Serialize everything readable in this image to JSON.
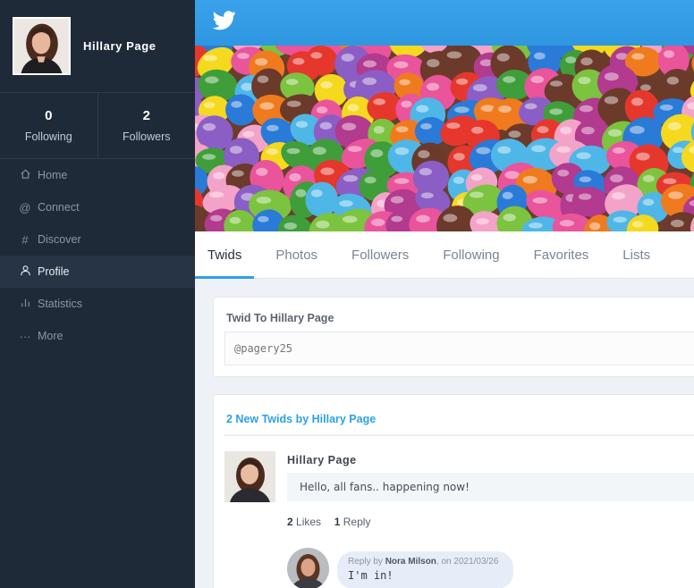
{
  "profile": {
    "name": "Hillary Page"
  },
  "stats": [
    {
      "value": "0",
      "label": "Following"
    },
    {
      "value": "2",
      "label": "Followers"
    }
  ],
  "nav": [
    {
      "icon": "home-icon",
      "label": "Home"
    },
    {
      "icon": "at-icon",
      "label": "Connect"
    },
    {
      "icon": "hash-icon",
      "label": "Discover"
    },
    {
      "icon": "user-icon",
      "label": "Profile",
      "active": true
    },
    {
      "icon": "bar-chart-icon",
      "label": "Statistics"
    },
    {
      "icon": "more-icon",
      "label": "More"
    }
  ],
  "tabs": [
    "Twids",
    "Photos",
    "Followers",
    "Following",
    "Favorites",
    "Lists"
  ],
  "active_tab": "Twids",
  "compose": {
    "title": "Twid To Hillary Page",
    "placeholder": "@pagery25"
  },
  "feed": {
    "title": "2 New Twids by Hillary Page",
    "post": {
      "author": "Hillary Page",
      "text": "Hello, all fans.. happening now!",
      "likes_count": "2",
      "likes_label": "Likes",
      "replies_count": "1",
      "replies_label": "Reply"
    },
    "reply": {
      "prefix": "Reply by",
      "author": "Nora Milson",
      "date_text": ", on 2021/03/26",
      "text": "I'm in!"
    }
  },
  "colors": {
    "sidebar": "#1f2a38",
    "accent": "#2ea0ea",
    "topbar": "#3aa2ea"
  }
}
